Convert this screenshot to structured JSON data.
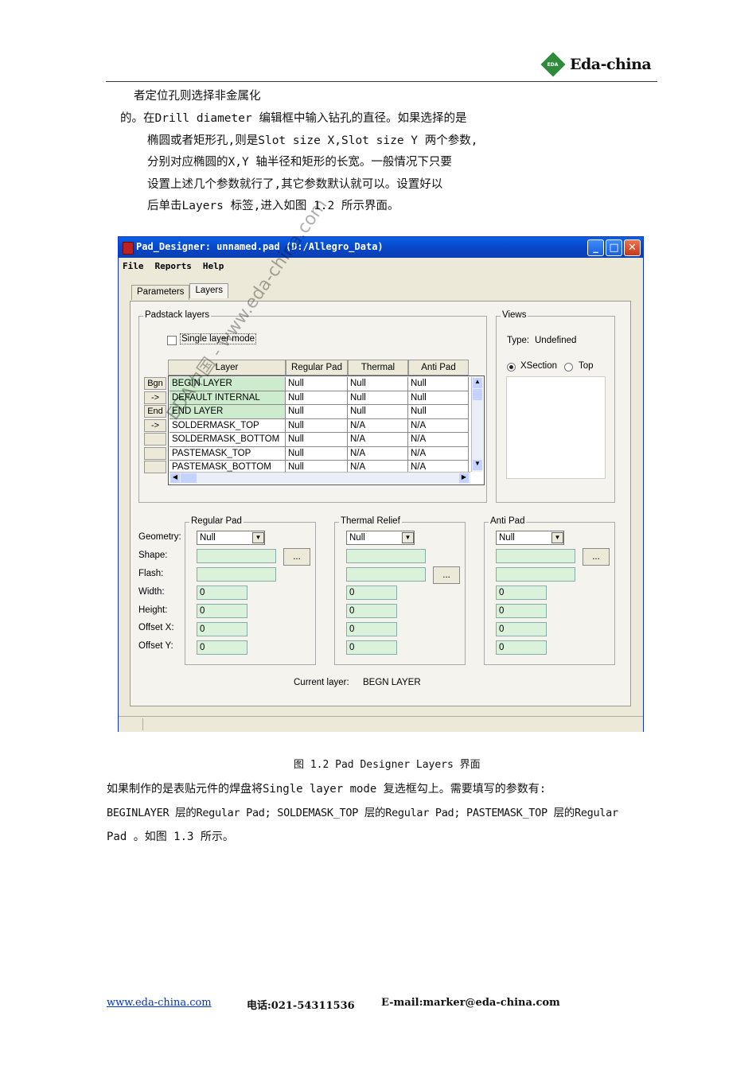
{
  "header": {
    "logo_badge": "EDA",
    "logo_text": "Eda-china"
  },
  "intro": [
    "者定位孔则选择非金属化",
    "的。在Drill diameter 编辑框中输入钻孔的直径。如果选择的是",
    "椭圆或者矩形孔,则是Slot size X,Slot size Y 两个参数,",
    "分别对应椭圆的X,Y 轴半径和矩形的长宽。一般情况下只要",
    "设置上述几个参数就行了,其它参数默认就可以。设置好以",
    "后单击Layers 标签,进入如图 1.2 所示界面。"
  ],
  "window": {
    "title": "Pad_Designer: unnamed.pad (D:/Allegro_Data)",
    "menu": [
      "File",
      "Reports",
      "Help"
    ],
    "tabs": [
      "Parameters",
      "Layers"
    ],
    "padstack": {
      "group_label": "Padstack layers",
      "single_layer_label": "Single layer mode",
      "columns": [
        "Layer",
        "Regular Pad",
        "Thermal Relief",
        "Anti Pad"
      ],
      "row_buttons": [
        "Bgn",
        "->",
        "End",
        "->",
        "",
        "",
        ""
      ],
      "rows": [
        [
          "BEGIN LAYER",
          "Null",
          "Null",
          "Null"
        ],
        [
          "DEFAULT INTERNAL",
          "Null",
          "Null",
          "Null"
        ],
        [
          "END LAYER",
          "Null",
          "Null",
          "Null"
        ],
        [
          "SOLDERMASK_TOP",
          "Null",
          "N/A",
          "N/A"
        ],
        [
          "SOLDERMASK_BOTTOM",
          "Null",
          "N/A",
          "N/A"
        ],
        [
          "PASTEMASK_TOP",
          "Null",
          "N/A",
          "N/A"
        ],
        [
          "PASTEMASK_BOTTOM",
          "Null",
          "N/A",
          "N/A"
        ]
      ]
    },
    "views": {
      "group_label": "Views",
      "type_label": "Type:",
      "type_value": "Undefined",
      "radio1": "XSection",
      "radio2": "Top"
    },
    "field_labels": [
      "Geometry:",
      "Shape:",
      "Flash:",
      "Width:",
      "Height:",
      "Offset X:",
      "Offset Y:"
    ],
    "pads": [
      {
        "label": "Regular Pad",
        "geometry": "Null",
        "values": [
          "0",
          "0",
          "0",
          "0"
        ]
      },
      {
        "label": "Thermal Relief",
        "geometry": "Null",
        "values": [
          "0",
          "0",
          "0",
          "0"
        ]
      },
      {
        "label": "Anti Pad",
        "geometry": "Null",
        "values": [
          "0",
          "0",
          "0",
          "0"
        ]
      }
    ],
    "browse_label": "...",
    "current_layer_label": "Current layer:",
    "current_layer_value": "BEGN LAYER"
  },
  "watermark": "EDA中国 - www.eda-china.com",
  "caption": "图 1.2 Pad Designer Layers 界面",
  "body": [
    "如果制作的是表贴元件的焊盘将Single layer mode 复选框勾上。需要填写的参数有:",
    "BEGINLAYER 层的Regular Pad; SOLDEMASK_TOP 层的Regular Pad; PASTEMASK_TOP 层的Regular",
    "Pad 。如图 1.3 所示。"
  ],
  "footer": {
    "site": "www.eda-china.com",
    "phone": "电话:021-54311536",
    "email": "E-mail:marker@eda-china.com"
  }
}
